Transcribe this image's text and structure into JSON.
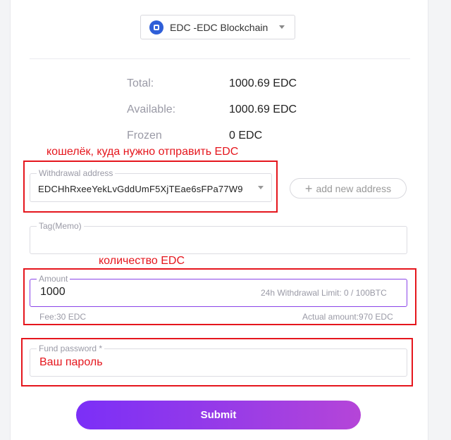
{
  "selector": {
    "label": "EDC -EDC Blockchain",
    "icon": "edc-coin-icon"
  },
  "balances": [
    {
      "key": "Total:",
      "value": "1000.69 EDC"
    },
    {
      "key": "Available:",
      "value": "1000.69 EDC"
    },
    {
      "key": "Frozen",
      "value": "0 EDC"
    }
  ],
  "annotations": {
    "wallet": "кошелёк, куда нужно отправить EDC",
    "amount": "количество EDC"
  },
  "withdrawal": {
    "label": "Withdrawal address",
    "value": "EDCHhRxeeYekLvGddUmF5XjTEae6sFPa77W9",
    "add_new": "add new address"
  },
  "tag": {
    "label": "Tag(Memo)",
    "value": ""
  },
  "amount": {
    "label": "Amount",
    "value": "1000",
    "limit": "24h Withdrawal Limit:  0 / 100BTC",
    "fee": "Fee:30 EDC",
    "actual": "Actual amount:970 EDC"
  },
  "password": {
    "label": "Fund password *",
    "value": "Ваш пароль"
  },
  "submit_label": "Submit",
  "colors": {
    "accent": "#8a43e8",
    "annotation_red": "#e5161d",
    "coin_blue": "#2f5fd8"
  }
}
